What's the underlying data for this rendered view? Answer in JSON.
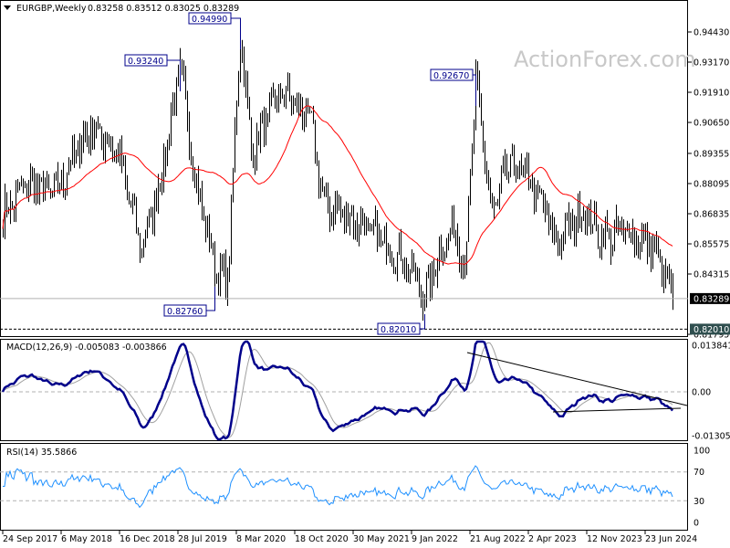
{
  "header": {
    "menu_icon": "triangle-down-icon",
    "symbol": "EURGBP,Weekly",
    "ohlc": "0.83258 0.83512 0.83025 0.83289"
  },
  "watermark": "ActionForex.com",
  "colors": {
    "bars": "#000000",
    "sma": "#ff0000",
    "macd": "#00008b",
    "signal": "#a0a0a0",
    "rsi": "#1e90ff",
    "trendline": "#000000"
  },
  "chart_data": [
    {
      "type": "line",
      "title": "EURGBP,Weekly",
      "subtype": "ohlc-bars-with-moving-average",
      "y_ticks": [
        "0.94430",
        "0.93170",
        "0.91910",
        "0.90650",
        "0.89355",
        "0.88095",
        "0.86835",
        "0.85575",
        "0.84315",
        "0.81795"
      ],
      "ylim": [
        0.81795,
        0.9443
      ],
      "current_price": "0.83289",
      "support_level": "0.82010",
      "x_ticks": [
        "24 Sep 2017",
        "6 May 2018",
        "16 Dec 2018",
        "28 Jul 2019",
        "8 Mar 2020",
        "18 Oct 2020",
        "30 May 2021",
        "9 Jan 2022",
        "21 Aug 2022",
        "2 Apr 2023",
        "12 Nov 2023",
        "23 Jun 2024"
      ],
      "annotations": [
        {
          "label": "0.93240",
          "date": "2019-08-04"
        },
        {
          "label": "0.94990",
          "date": "2020-03-22"
        },
        {
          "label": "0.82760",
          "date": "2019-12-15"
        },
        {
          "label": "0.92670",
          "date": "2022-09-11"
        },
        {
          "label": "0.82010",
          "date": "2022-02-27"
        }
      ],
      "approx_close_path": [
        [
          "2017-09-24",
          0.868
        ],
        [
          "2017-12-24",
          0.881
        ],
        [
          "2018-04-08",
          0.877
        ],
        [
          "2018-08-26",
          0.905
        ],
        [
          "2018-12-09",
          0.894
        ],
        [
          "2019-03-10",
          0.853
        ],
        [
          "2019-05-19",
          0.882
        ],
        [
          "2019-08-04",
          0.93
        ],
        [
          "2019-10-06",
          0.881
        ],
        [
          "2019-12-15",
          0.846
        ],
        [
          "2020-02-02",
          0.839
        ],
        [
          "2020-03-22",
          0.945
        ],
        [
          "2020-05-03",
          0.895
        ],
        [
          "2020-08-30",
          0.92
        ],
        [
          "2020-12-13",
          0.908
        ],
        [
          "2021-02-07",
          0.872
        ],
        [
          "2021-05-02",
          0.868
        ],
        [
          "2021-09-19",
          0.857
        ],
        [
          "2022-01-02",
          0.846
        ],
        [
          "2022-02-27",
          0.833
        ],
        [
          "2022-04-17",
          0.85
        ],
        [
          "2022-06-26",
          0.863
        ],
        [
          "2022-07-31",
          0.845
        ],
        [
          "2022-09-11",
          0.922
        ],
        [
          "2022-11-13",
          0.868
        ],
        [
          "2023-01-22",
          0.89
        ],
        [
          "2023-04-02",
          0.883
        ],
        [
          "2023-06-11",
          0.868
        ],
        [
          "2023-07-16",
          0.856
        ],
        [
          "2023-10-29",
          0.87
        ],
        [
          "2024-01-07",
          0.858
        ],
        [
          "2024-04-21",
          0.861
        ],
        [
          "2024-08-04",
          0.852
        ],
        [
          "2024-10-06",
          0.83289
        ]
      ]
    },
    {
      "type": "line",
      "title": "MACD(12,26,9) -0.005083 -0.003866",
      "y_ticks": [
        "0.013841",
        "0.00",
        "-0.013052"
      ],
      "ylim": [
        -0.013052,
        0.013841
      ],
      "series": [
        {
          "name": "MACD",
          "last": -0.005083
        },
        {
          "name": "Signal",
          "last": -0.003866
        }
      ]
    },
    {
      "type": "line",
      "title": "RSI(14) 35.5866",
      "y_ticks": [
        "100",
        "70",
        "30",
        "0"
      ],
      "ylim": [
        0,
        100
      ],
      "levels": [
        70,
        30
      ],
      "series": [
        {
          "name": "RSI(14)",
          "last": 35.5866
        }
      ]
    }
  ]
}
